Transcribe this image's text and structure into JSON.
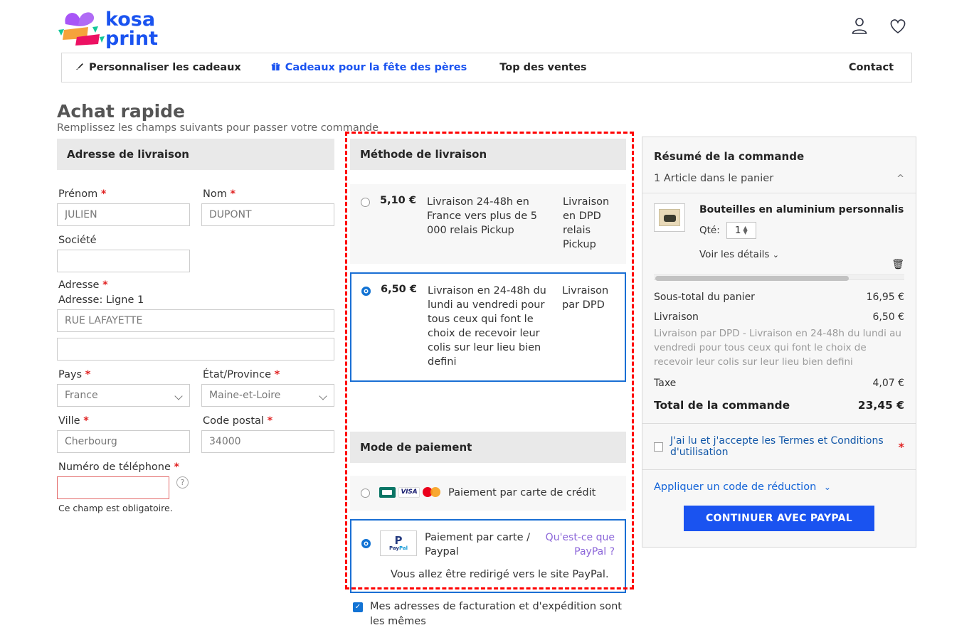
{
  "brand": {
    "name_line1": "kosa",
    "name_line2": "print",
    "color": "#1a53f0"
  },
  "header": {
    "account_icon": "person-icon",
    "wishlist_icon": "heart-icon"
  },
  "nav": {
    "items": [
      {
        "label": "Personnaliser les cadeaux",
        "icon": "brush-icon",
        "highlight": false
      },
      {
        "label": "Cadeaux pour la fête des pères",
        "icon": "gift-icon",
        "highlight": true
      },
      {
        "label": "Top des ventes",
        "icon": "",
        "highlight": false
      },
      {
        "label": "Contact",
        "icon": "",
        "highlight": false
      }
    ]
  },
  "page": {
    "title": "Achat rapide",
    "subtitle": "Remplissez les champs suivants pour passer votre commande"
  },
  "shipping_address": {
    "heading": "Adresse de livraison",
    "fields": {
      "firstname_label": "Prénom",
      "firstname_value": "JULIEN",
      "lastname_label": "Nom",
      "lastname_value": "DUPONT",
      "company_label": "Société",
      "company_value": "",
      "address_label": "Adresse",
      "address_line1_label": "Adresse: Ligne 1",
      "address_line1_value": "RUE LAFAYETTE",
      "address_line2_value": "",
      "country_label": "Pays",
      "country_value": "France",
      "state_label": "État/Province",
      "state_value": "Maine-et-Loire",
      "city_label": "Ville",
      "city_value": "Cherbourg",
      "zip_label": "Code postal",
      "zip_value": "34000",
      "phone_label": "Numéro de téléphone",
      "phone_value": "",
      "phone_error": "Ce champ est obligatoire.",
      "help_icon": "question-mark-icon"
    },
    "required_marker": "*"
  },
  "delivery": {
    "heading": "Méthode de livraison",
    "options": [
      {
        "price": "5,10 €",
        "description": "Livraison 24-48h en France vers plus de 5 000 relais Pickup",
        "carrier": "Livraison en DPD relais Pickup",
        "selected": false
      },
      {
        "price": "6,50 €",
        "description": "Livraison en 24-48h du lundi au vendredi pour tous ceux qui font le choix de recevoir leur colis sur leur lieu bien defini",
        "carrier": "Livraison par DPD",
        "selected": true
      }
    ]
  },
  "payment": {
    "heading": "Mode de paiement",
    "options": [
      {
        "label": "Paiement par carte de crédit",
        "icons": [
          "cb-card-icon",
          "visa-card-icon",
          "mastercard-icon"
        ],
        "selected": false
      },
      {
        "label": "Paiement par carte / Paypal",
        "link": "Qu'est-ce que PayPal ?",
        "note": "Vous allez être redirigé vers le site PayPal.",
        "icons": [
          "paypal-logo-icon"
        ],
        "selected": true
      }
    ]
  },
  "same_address": {
    "label": "Mes adresses de facturation et d'expédition sont les mêmes",
    "checked": true
  },
  "summary": {
    "title": "Résumé de la commande",
    "cart_header": "1 Article dans le panier",
    "collapse_icon": "chevron-up-icon",
    "item": {
      "name": "Bouteilles en aluminium personnalis",
      "qty_label": "Qté:",
      "qty_value": "1",
      "details_link": "Voir les détails",
      "thumbnail_icon": "product-thumbnail",
      "delete_icon": "trash-icon"
    },
    "lines": [
      {
        "label": "Sous-total du panier",
        "value": "16,95 €"
      },
      {
        "label": "Livraison",
        "value": "6,50 €"
      },
      {
        "label": "Taxe",
        "value": "4,07 €"
      }
    ],
    "shipping_note": "Livraison par DPD - Livraison en 24-48h du lundi au vendredi pour tous ceux qui font le choix de recevoir leur colis sur leur lieu bien defini",
    "total_label": "Total de la commande",
    "total_value": "23,45 €",
    "terms_label": "J'ai lu et j'accepte les Termes et Conditions d'utilisation",
    "terms_required": "*",
    "terms_checked": false,
    "promo_label": "Appliquer un code de réduction",
    "cta_label": "CONTINUER AVEC PAYPAL"
  }
}
